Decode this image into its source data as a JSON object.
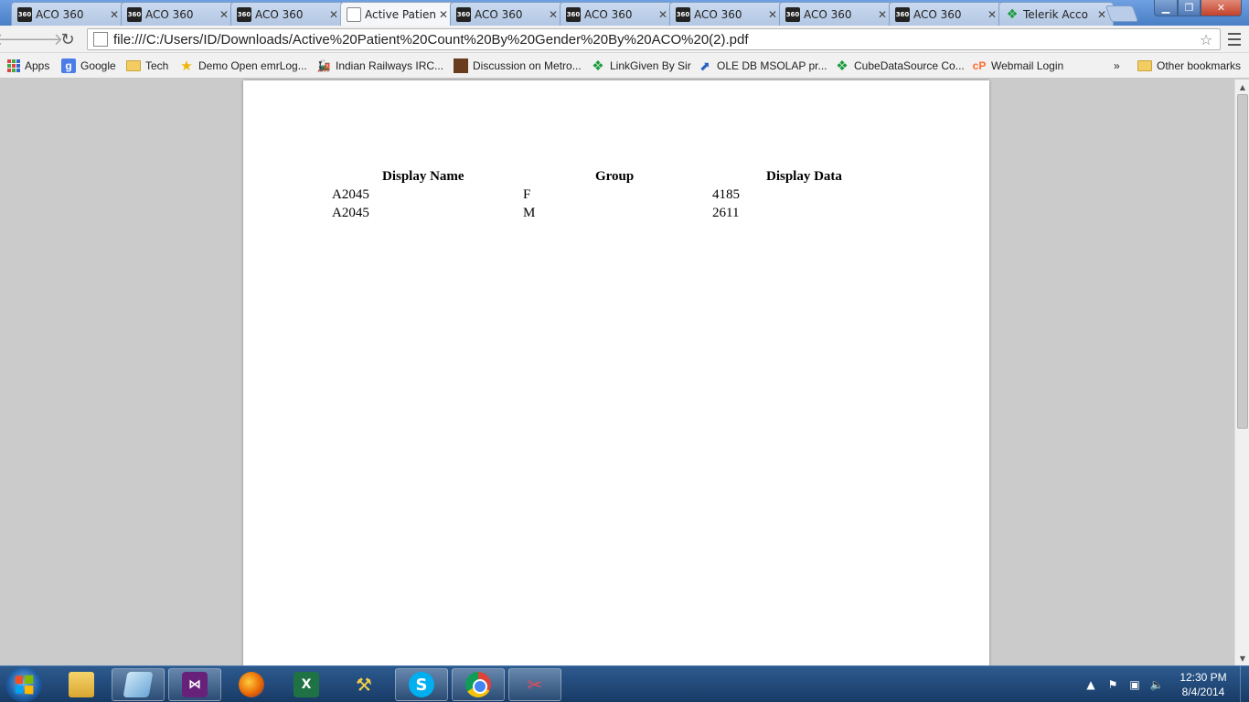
{
  "browser": {
    "tabs": [
      {
        "label": "ACO 360",
        "icon": "aco360-favicon",
        "active": false
      },
      {
        "label": "ACO 360",
        "icon": "aco360-favicon",
        "active": false
      },
      {
        "label": "ACO 360",
        "icon": "aco360-favicon",
        "active": false
      },
      {
        "label": "Active Patien",
        "icon": "document-favicon",
        "active": true
      },
      {
        "label": "ACO 360",
        "icon": "aco360-favicon",
        "active": false
      },
      {
        "label": "ACO 360",
        "icon": "aco360-favicon",
        "active": false
      },
      {
        "label": "ACO 360",
        "icon": "aco360-favicon",
        "active": false
      },
      {
        "label": "ACO 360",
        "icon": "aco360-favicon",
        "active": false
      },
      {
        "label": "ACO 360",
        "icon": "aco360-favicon",
        "active": false
      },
      {
        "label": "Telerik Acco",
        "icon": "telerik-favicon",
        "active": false
      }
    ],
    "favicon_text": "360",
    "url": "file:///C:/Users/ID/Downloads/Active%20Patient%20Count%20By%20Gender%20By%20ACO%20(2).pdf",
    "bookmarks": [
      {
        "label": "Apps",
        "icon": "apps-grid-icon"
      },
      {
        "label": "Google",
        "icon": "google-icon"
      },
      {
        "label": "Tech",
        "icon": "folder-icon"
      },
      {
        "label": "Demo Open emrLog...",
        "icon": "star-icon"
      },
      {
        "label": "Indian Railways IRC...",
        "icon": "railway-icon"
      },
      {
        "label": "Discussion on Metro...",
        "icon": "discussion-icon"
      },
      {
        "label": "LinkGiven By Sir",
        "icon": "telerik-icon"
      },
      {
        "label": "OLE DB MSOLAP pr...",
        "icon": "ole-db-icon"
      },
      {
        "label": "CubeDataSource Co...",
        "icon": "telerik-icon"
      },
      {
        "label": "Webmail Login",
        "icon": "cpanel-icon"
      }
    ],
    "bookmarks_overflow": "»",
    "other_bookmarks": "Other bookmarks"
  },
  "document": {
    "headers": {
      "name": "Display Name",
      "group": "Group",
      "data": "Display Data"
    },
    "rows": [
      {
        "name": "A2045",
        "group": "F",
        "data": "4185"
      },
      {
        "name": "A2045",
        "group": "M",
        "data": "2611"
      }
    ]
  },
  "taskbar": {
    "apps": [
      "windows-explorer",
      "notepad",
      "visual-studio",
      "firefox",
      "excel",
      "tools",
      "skype",
      "chrome",
      "snipping-tool"
    ],
    "excel_letter": "X",
    "skype_letter": "S",
    "vs_glyph": "⋈",
    "clock_time": "12:30 PM",
    "clock_date": "8/4/2014"
  },
  "colors": {
    "titlebar": "#5d8fd3",
    "taskbar": "#1e4470",
    "page_background": "#cbcbcb"
  }
}
